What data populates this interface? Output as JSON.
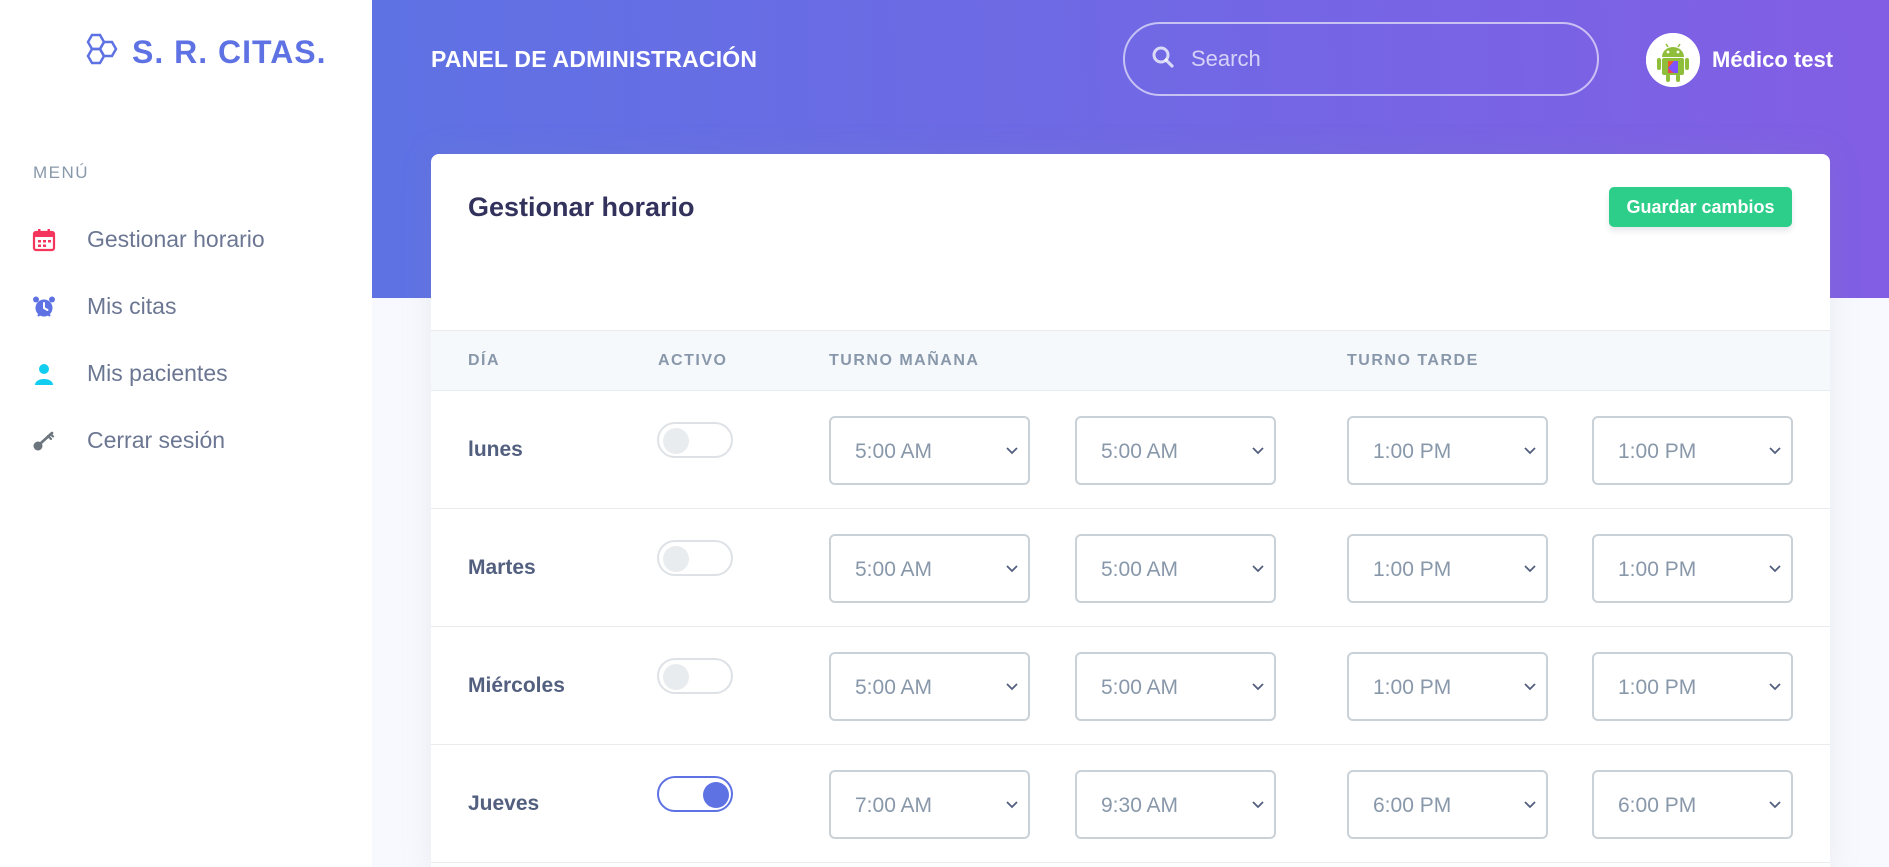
{
  "brand": {
    "name": "S. R. CITAS."
  },
  "sidebar": {
    "heading": "MENÚ",
    "items": [
      {
        "label": "Gestionar horario",
        "icon": "calendar-icon",
        "color": "#f5365c"
      },
      {
        "label": "Mis citas",
        "icon": "alarm-clock-icon",
        "color": "#5e72e4"
      },
      {
        "label": "Mis pacientes",
        "icon": "user-icon",
        "color": "#11cdef"
      },
      {
        "label": "Cerrar sesión",
        "icon": "key-icon",
        "color": "#6c757d"
      }
    ]
  },
  "header": {
    "title": "PANEL DE ADMINISTRACIÓN",
    "search_placeholder": "Search",
    "user_name": "Médico test"
  },
  "card": {
    "title": "Gestionar horario",
    "save_label": "Guardar cambios"
  },
  "table": {
    "headers": {
      "day": "DÍA",
      "active": "ACTIVO",
      "morning": "TURNO MAÑANA",
      "afternoon": "TURNO TARDE"
    },
    "rows": [
      {
        "day": "lunes",
        "active": false,
        "morning_start": "5:00 AM",
        "morning_end": "5:00 AM",
        "afternoon_start": "1:00 PM",
        "afternoon_end": "1:00 PM"
      },
      {
        "day": "Martes",
        "active": false,
        "morning_start": "5:00 AM",
        "morning_end": "5:00 AM",
        "afternoon_start": "1:00 PM",
        "afternoon_end": "1:00 PM"
      },
      {
        "day": "Miércoles",
        "active": false,
        "morning_start": "5:00 AM",
        "morning_end": "5:00 AM",
        "afternoon_start": "1:00 PM",
        "afternoon_end": "1:00 PM"
      },
      {
        "day": "Jueves",
        "active": true,
        "morning_start": "7:00 AM",
        "morning_end": "9:30 AM",
        "afternoon_start": "6:00 PM",
        "afternoon_end": "6:00 PM"
      }
    ]
  },
  "colors": {
    "primary": "#5e72e4",
    "success": "#2dce89",
    "gradient_end": "#825ee4"
  }
}
